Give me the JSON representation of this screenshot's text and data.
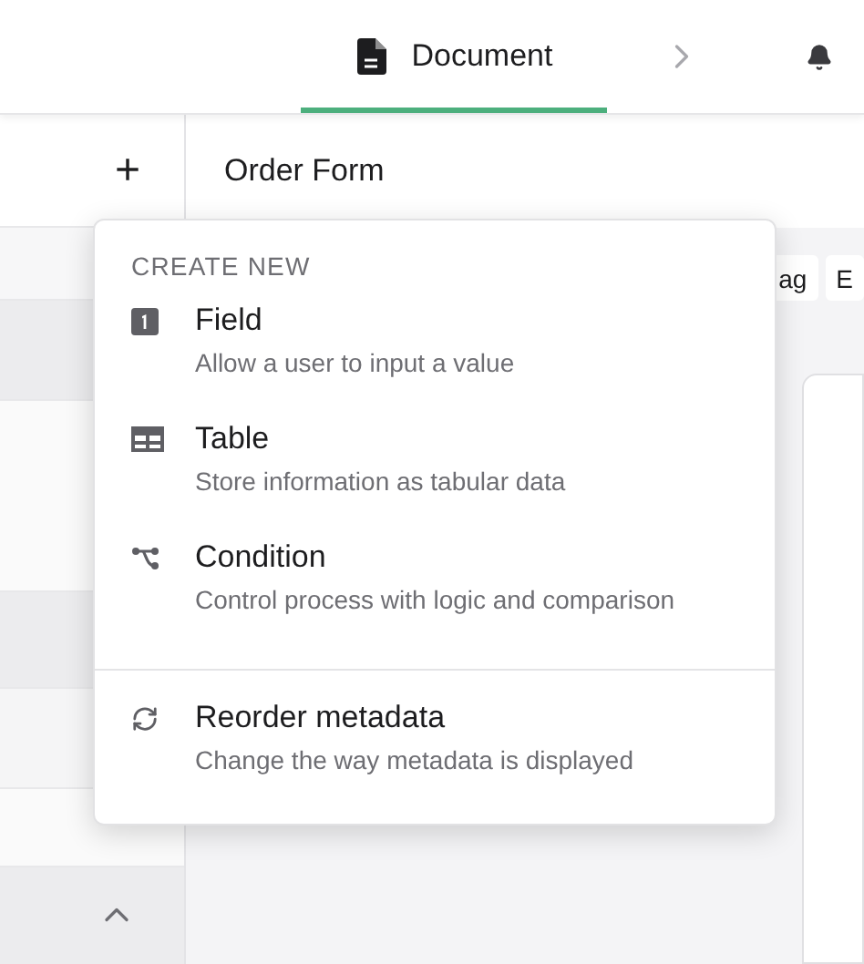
{
  "header": {
    "tabs": [
      {
        "label": "Document",
        "selected": true
      }
    ]
  },
  "sidebar": {
    "add_button": "+"
  },
  "form": {
    "title": "Order Form",
    "toolbar_buttons": [
      "ag",
      "E"
    ]
  },
  "menu": {
    "heading": "CREATE NEW",
    "items": [
      {
        "kind": "field",
        "title": "Field",
        "description": "Allow a user to input a value",
        "separated": false
      },
      {
        "kind": "table",
        "title": "Table",
        "description": "Store information as tabular data",
        "separated": false
      },
      {
        "kind": "condition",
        "title": "Condition",
        "description": "Control process with logic and comparison",
        "separated": false
      },
      {
        "kind": "reorder",
        "title": "Reorder metadata",
        "description": "Change the way metadata is displayed",
        "separated": true
      }
    ]
  }
}
